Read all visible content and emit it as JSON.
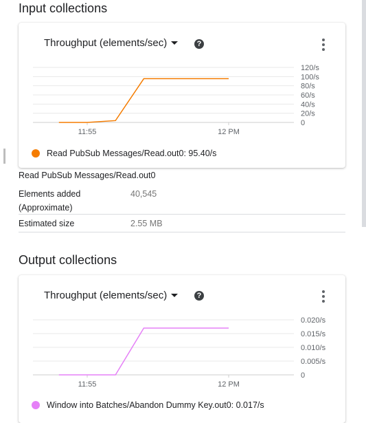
{
  "input": {
    "title": "Input collections",
    "metric_label": "Throughput (elements/sec)",
    "help": "?",
    "legend_label": "Read PubSub Messages/Read.out0:",
    "legend_value": "95.40/s",
    "collection_name": "Read PubSub Messages/Read.out0",
    "rows": [
      {
        "key": "Elements added",
        "key2": "(Approximate)",
        "value": "40,545"
      },
      {
        "key": "Estimated size",
        "value": "2.55 MB"
      }
    ]
  },
  "output": {
    "title": "Output collections",
    "metric_label": "Throughput (elements/sec)",
    "help": "?",
    "legend_label": "Window into Batches/Abandon Dummy Key.out0:",
    "legend_value": "0.017/s"
  },
  "chart_data": [
    {
      "type": "line",
      "x": [
        "11:54",
        "11:55",
        "11:56",
        "11:57",
        "12:00"
      ],
      "x_minutes": [
        54,
        55,
        56,
        57,
        60
      ],
      "series": [
        {
          "name": "Read PubSub Messages/Read.out0",
          "values": [
            0,
            0,
            4,
            95.4,
            95.4
          ],
          "color": "#f57c00"
        }
      ],
      "y_ticks": [
        "0",
        "20/s",
        "40/s",
        "60/s",
        "80/s",
        "100/s",
        "120/s"
      ],
      "y_tick_values": [
        0,
        20,
        40,
        60,
        80,
        100,
        120
      ],
      "ylim": [
        0,
        120
      ],
      "x_ticks": [
        "11:55",
        "12 PM"
      ],
      "x_tick_minutes": [
        55,
        60
      ],
      "grid": true
    },
    {
      "type": "line",
      "x": [
        "11:54",
        "11:55",
        "11:56",
        "11:57",
        "12:00"
      ],
      "x_minutes": [
        54,
        55,
        56,
        57,
        60
      ],
      "series": [
        {
          "name": "Window into Batches/Abandon Dummy Key.out0",
          "values": [
            0,
            0,
            0,
            0.017,
            0.017
          ],
          "color": "#e580f7"
        }
      ],
      "y_ticks": [
        "0",
        "0.005/s",
        "0.010/s",
        "0.015/s",
        "0.020/s"
      ],
      "y_tick_values": [
        0,
        0.005,
        0.01,
        0.015,
        0.02
      ],
      "ylim": [
        0,
        0.02
      ],
      "x_ticks": [
        "11:55",
        "12 PM"
      ],
      "x_tick_minutes": [
        55,
        60
      ],
      "grid": true
    }
  ]
}
